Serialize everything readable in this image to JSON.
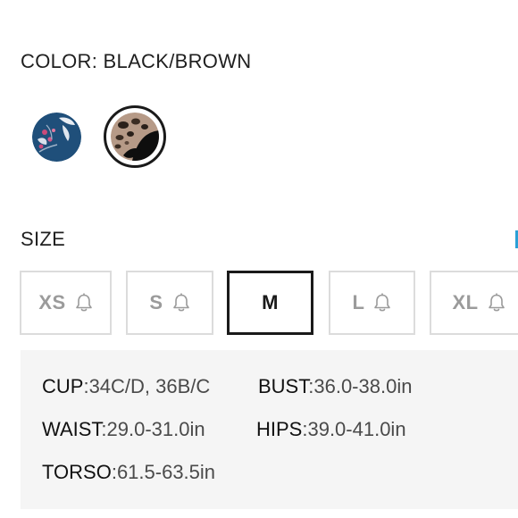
{
  "color": {
    "label": "COLOR: BLACK/BROWN",
    "swatches": [
      {
        "name": "blue floral",
        "selected": false
      },
      {
        "name": "black/brown leopard",
        "selected": true
      }
    ]
  },
  "size": {
    "label": "SIZE",
    "options": [
      {
        "label": "XS",
        "selected": false,
        "notify_icon": "bell-icon"
      },
      {
        "label": "S",
        "selected": false,
        "notify_icon": "bell-icon"
      },
      {
        "label": "M",
        "selected": true
      },
      {
        "label": "L",
        "selected": false,
        "notify_icon": "bell-icon"
      },
      {
        "label": "XL",
        "selected": false,
        "notify_icon": "bell-icon"
      }
    ]
  },
  "measurements": {
    "cup": {
      "key": "CUP",
      "value": ":34C/D, 36B/C"
    },
    "bust": {
      "key": "BUST",
      "value": ":36.0-38.0in"
    },
    "waist": {
      "key": "WAIST",
      "value": ":29.0-31.0in"
    },
    "hips": {
      "key": "HIPS",
      "value": ":39.0-41.0in"
    },
    "torso": {
      "key": "TORSO",
      "value": ":61.5-63.5in"
    }
  },
  "colors": {
    "text": "#1f1f1f",
    "muted_size": "#9b9b9b",
    "border": "#dcdcdc",
    "selected_border": "#1a1a1a",
    "panel_bg": "#f5f5f5",
    "accent": "#2aa0d6"
  }
}
